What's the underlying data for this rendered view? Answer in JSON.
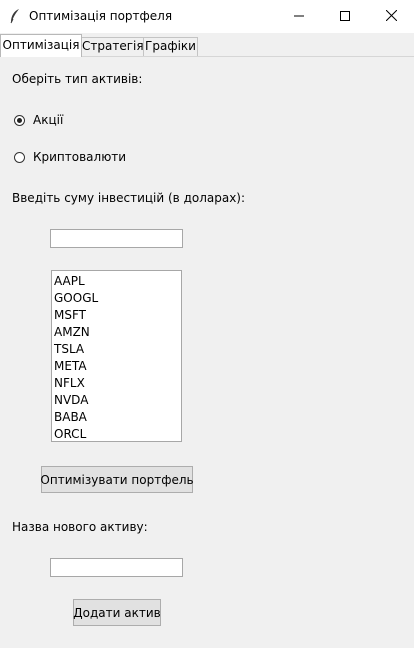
{
  "window": {
    "title": "Оптимізація портфеля",
    "icon": "feather-icon",
    "controls": [
      "minimize-icon",
      "maximize-icon",
      "close-icon"
    ]
  },
  "tabs": [
    {
      "label": "Оптимізація",
      "active": true
    },
    {
      "label": "Стратегія",
      "active": false
    },
    {
      "label": "Графіки",
      "active": false
    }
  ],
  "form": {
    "asset_type_label": "Оберіть тип активів:",
    "radio_options": [
      {
        "label": "Акції",
        "selected": true
      },
      {
        "label": "Криптовалюти",
        "selected": false
      }
    ],
    "investment_label": "Введіть суму інвестицій (в доларах):",
    "investment_value": "",
    "assets": [
      "AAPL",
      "GOOGL",
      "MSFT",
      "AMZN",
      "TSLA",
      "META",
      "NFLX",
      "NVDA",
      "BABA",
      "ORCL"
    ],
    "optimize_button": "Оптимізувати портфель",
    "new_asset_label": "Назва нового активу:",
    "new_asset_value": "",
    "add_button": "Додати актив"
  }
}
